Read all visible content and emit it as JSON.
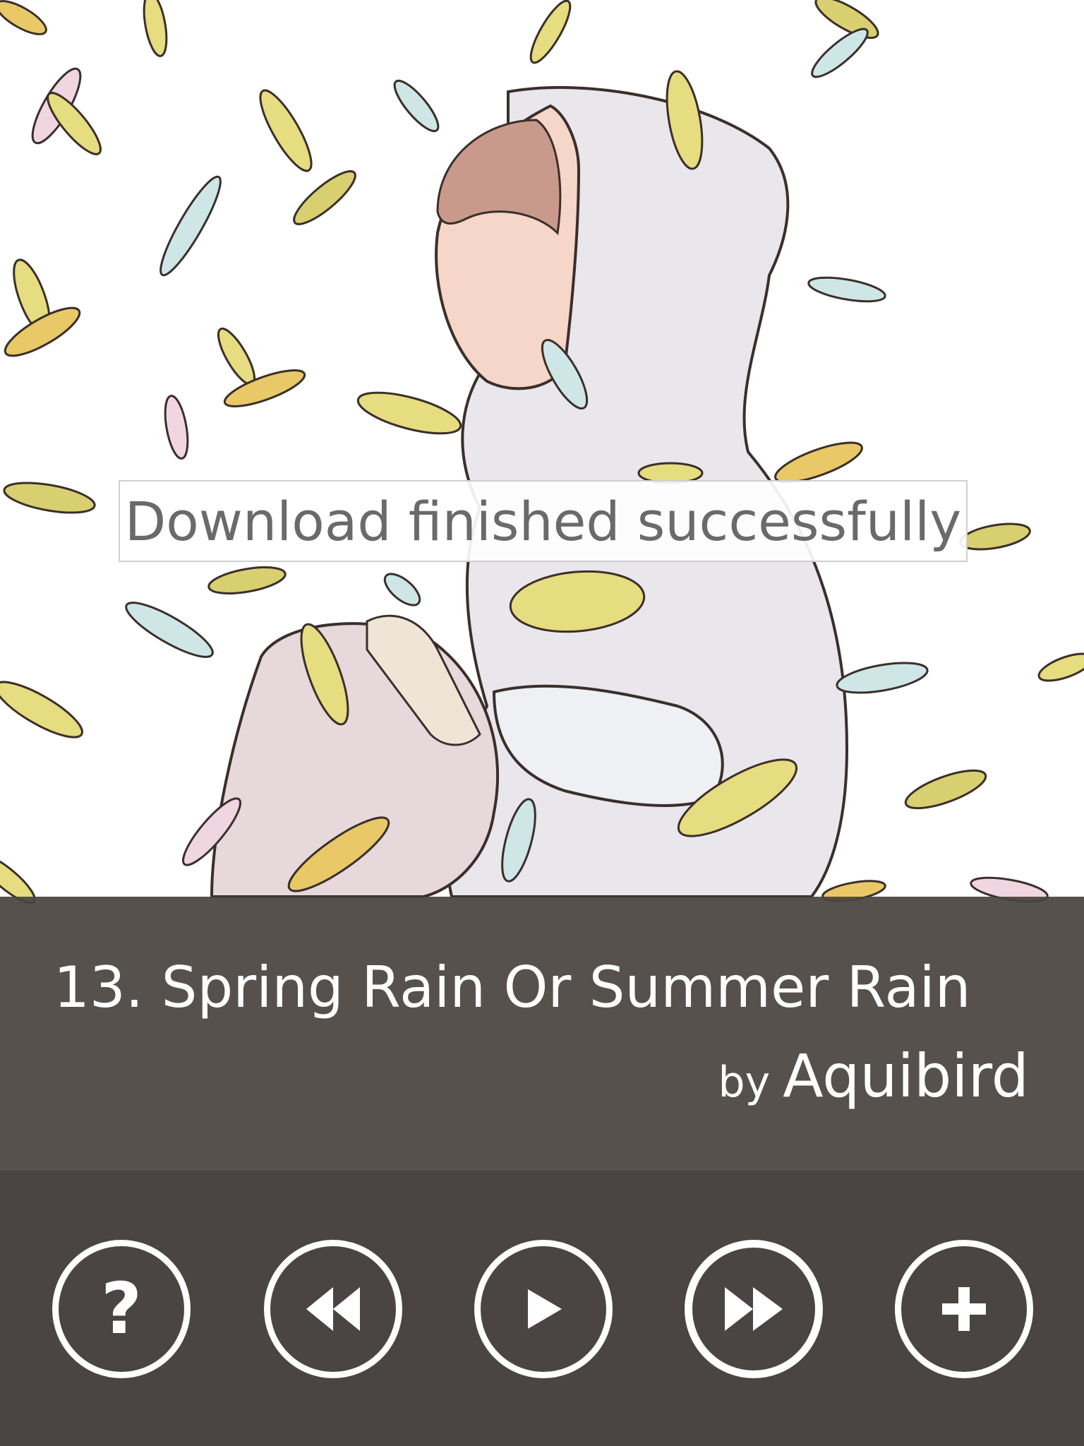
{
  "notification": {
    "message": "Download finished successfully"
  },
  "now_playing": {
    "track_title": "13. Spring Rain Or Summer Rain",
    "by_prefix": "by",
    "artist": "Aquibird"
  },
  "controls": {
    "help_glyph": "?",
    "buttons": [
      {
        "name": "help",
        "icon": "question-icon"
      },
      {
        "name": "previous",
        "icon": "rewind-icon"
      },
      {
        "name": "play",
        "icon": "play-icon"
      },
      {
        "name": "next",
        "icon": "fast-forward-icon"
      },
      {
        "name": "add",
        "icon": "plus-icon"
      }
    ]
  },
  "colors": {
    "panel": "#4a4542",
    "band": "#4a4440",
    "text": "#ffffff",
    "toast_text": "#6a6a6a"
  }
}
